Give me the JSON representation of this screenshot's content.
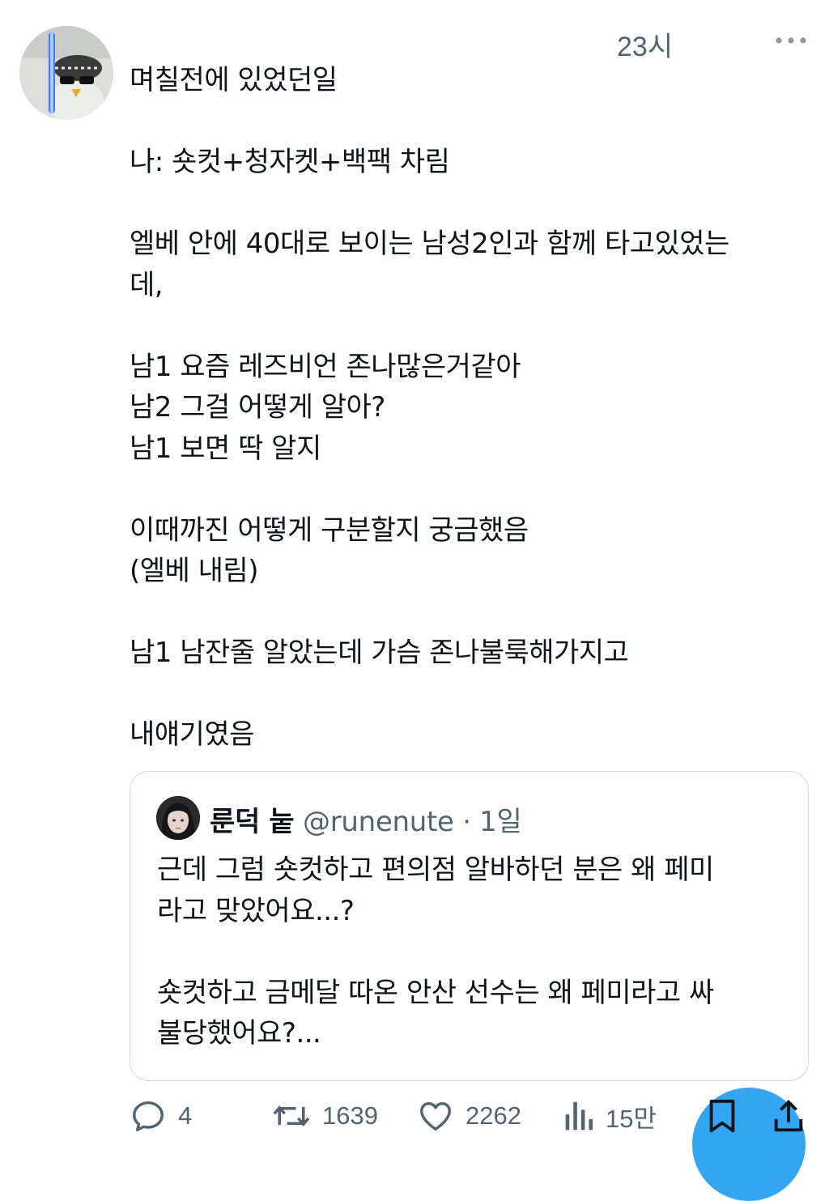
{
  "tweet": {
    "time": "23시",
    "avatar_icon": "profile-avatar-icon",
    "text": "며칠전에 있었던일\n\n나: 숏컷+청자켓+백팩 차림\n\n엘베 안에 40대로 보이는 남성2인과 함께 타고있었는\n데,\n\n남1 요즘 레즈비언 존나많은거같아\n남2 그걸 어떻게 알아?\n남1 보면 딱 알지\n\n이때까진 어떻게 구분할지 궁금했음\n(엘베 내림)\n\n남1 남잔줄 알았는데 가슴 존나불룩해가지고\n\n내얘기였음"
  },
  "quote": {
    "name": "룬덕 눝",
    "handle": "@runenute",
    "time": "· 1일",
    "text": "근데 그럼 숏컷하고 편의점 알바하던 분은 왜 페미\n라고 맞았어요...?\n\n숏컷하고 금메달 따온 안산 선수는 왜 페미라고 싸\n불당했어요?..."
  },
  "actions": {
    "replies": "4",
    "retweets": "1639",
    "likes": "2262",
    "views": "15만"
  },
  "icons": [
    "more-icon",
    "reply-icon",
    "retweet-icon",
    "like-icon",
    "views-icon",
    "bookmark-icon",
    "share-icon"
  ],
  "colors": {
    "accent": "#1d9bf0",
    "secondary_text": "#536471",
    "border": "#cfd9de"
  }
}
